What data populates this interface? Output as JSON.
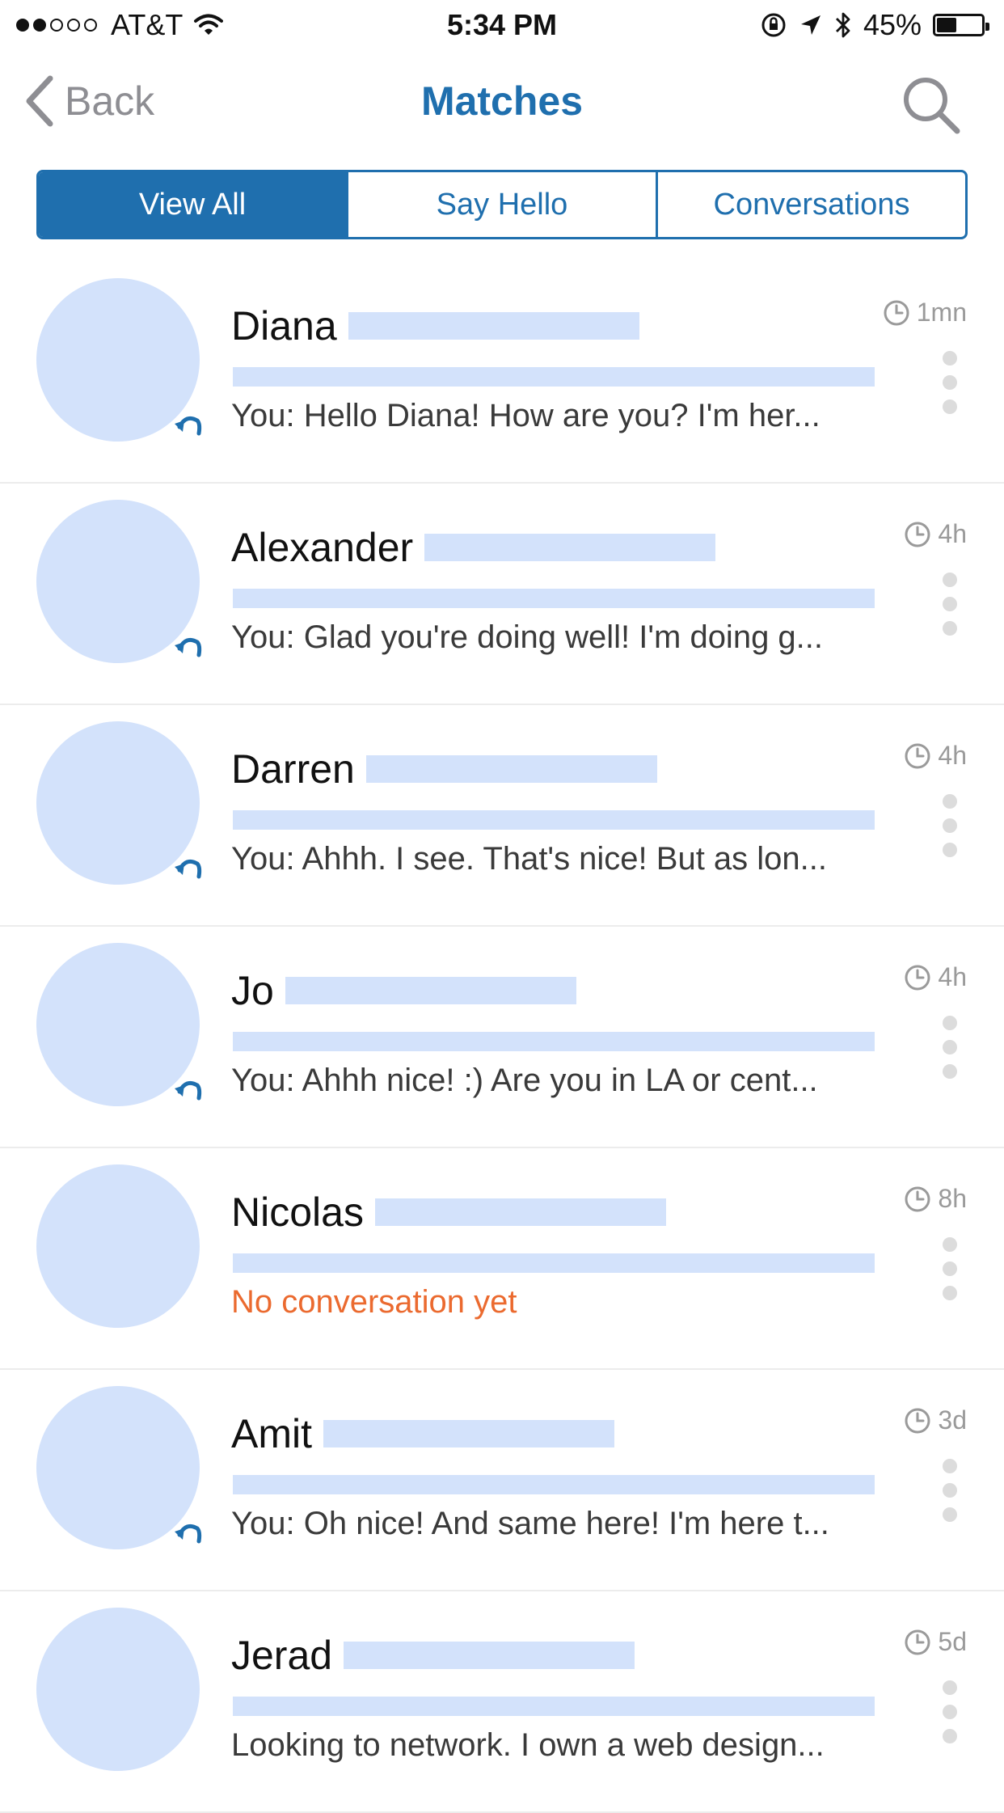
{
  "status_bar": {
    "carrier": "AT&T",
    "signal_bars": 2,
    "time": "5:34 PM",
    "battery_percent": "45%",
    "battery_level": 0.45
  },
  "nav": {
    "back_label": "Back",
    "title": "Matches"
  },
  "tabs": [
    {
      "label": "View All",
      "active": true
    },
    {
      "label": "Say Hello",
      "active": false
    },
    {
      "label": "Conversations",
      "active": false
    }
  ],
  "matches": [
    {
      "name": "Diana",
      "time": "1mn",
      "preview": "You: Hello Diana! How are you? I'm her...",
      "replied": true
    },
    {
      "name": "Alexander",
      "time": "4h",
      "preview": "You: Glad you're doing well! I'm doing g...",
      "replied": true
    },
    {
      "name": "Darren",
      "time": "4h",
      "preview": "You: Ahhh. I see. That's nice! But as lon...",
      "replied": true
    },
    {
      "name": "Jo",
      "time": "4h",
      "preview": "You: Ahhh nice! :) Are you in LA or cent...",
      "replied": true
    },
    {
      "name": "Nicolas",
      "time": "8h",
      "preview": "No conversation yet",
      "replied": false,
      "empty": true
    },
    {
      "name": "Amit",
      "time": "3d",
      "preview": "You: Oh nice! And same here! I'm here t...",
      "replied": true
    },
    {
      "name": "Jerad",
      "time": "5d",
      "preview": "Looking to network. I own a web design...",
      "replied": false
    }
  ],
  "colors": {
    "accent": "#1f6fae",
    "placeholder": "#d3e2fb",
    "empty_state": "#eb6a2f",
    "muted": "#9a9a9a"
  },
  "icons": {
    "back": "chevron-left-icon",
    "search": "search-icon",
    "clock": "clock-icon",
    "reply": "reply-icon",
    "more": "more-vertical-icon"
  }
}
